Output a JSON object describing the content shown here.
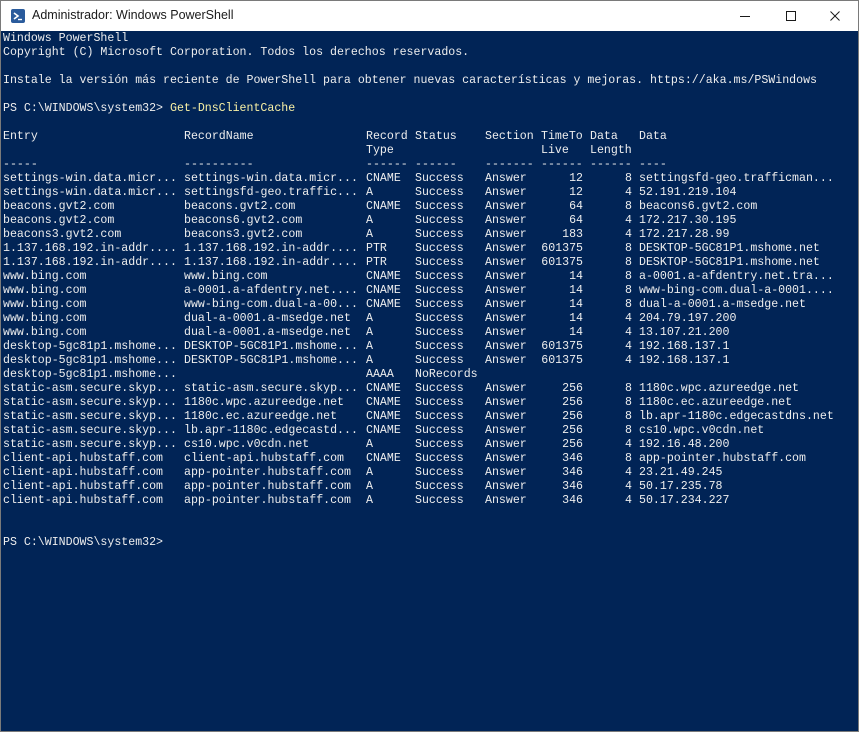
{
  "window": {
    "title": "Administrador: Windows PowerShell",
    "colors": {
      "background": "#012456",
      "text": "#eeeeee",
      "command": "#f9f1a5",
      "titlebar": "#ffffff"
    }
  },
  "console": {
    "banner": [
      "Windows PowerShell",
      "Copyright (C) Microsoft Corporation. Todos los derechos reservados.",
      "",
      "Instale la versión más reciente de PowerShell para obtener nuevas características y mejoras. https://aka.ms/PSWindows"
    ],
    "prompt": "PS C:\\WINDOWS\\system32> ",
    "command": "Get-DnsClientCache",
    "final_prompt": "PS C:\\WINDOWS\\system32>",
    "headers": {
      "entry": "Entry",
      "record_name": "RecordName",
      "record_type": [
        "Record",
        "Type"
      ],
      "status": "Status",
      "section": "Section",
      "ttl": [
        "TimeTo",
        "Live"
      ],
      "data_length": [
        "Data",
        "Length"
      ],
      "data": "Data"
    },
    "separators": {
      "entry": "-----",
      "record_name": "----------",
      "record_type": "------",
      "status": "------",
      "section": "-------",
      "ttl": "------",
      "data_length": "------",
      "data": "----"
    },
    "rows": [
      {
        "entry": "settings-win.data.micr...",
        "record_name": "settings-win.data.micr...",
        "type": "CNAME",
        "status": "Success",
        "section": "Answer",
        "ttl": "12",
        "length": "8",
        "data": "settingsfd-geo.trafficman..."
      },
      {
        "entry": "settings-win.data.micr...",
        "record_name": "settingsfd-geo.traffic...",
        "type": "A",
        "status": "Success",
        "section": "Answer",
        "ttl": "12",
        "length": "4",
        "data": "52.191.219.104"
      },
      {
        "entry": "beacons.gvt2.com",
        "record_name": "beacons.gvt2.com",
        "type": "CNAME",
        "status": "Success",
        "section": "Answer",
        "ttl": "64",
        "length": "8",
        "data": "beacons6.gvt2.com"
      },
      {
        "entry": "beacons.gvt2.com",
        "record_name": "beacons6.gvt2.com",
        "type": "A",
        "status": "Success",
        "section": "Answer",
        "ttl": "64",
        "length": "4",
        "data": "172.217.30.195"
      },
      {
        "entry": "beacons3.gvt2.com",
        "record_name": "beacons3.gvt2.com",
        "type": "A",
        "status": "Success",
        "section": "Answer",
        "ttl": "183",
        "length": "4",
        "data": "172.217.28.99"
      },
      {
        "entry": "1.137.168.192.in-addr....",
        "record_name": "1.137.168.192.in-addr....",
        "type": "PTR",
        "status": "Success",
        "section": "Answer",
        "ttl": "601375",
        "length": "8",
        "data": "DESKTOP-5GC81P1.mshome.net"
      },
      {
        "entry": "1.137.168.192.in-addr....",
        "record_name": "1.137.168.192.in-addr....",
        "type": "PTR",
        "status": "Success",
        "section": "Answer",
        "ttl": "601375",
        "length": "8",
        "data": "DESKTOP-5GC81P1.mshome.net"
      },
      {
        "entry": "www.bing.com",
        "record_name": "www.bing.com",
        "type": "CNAME",
        "status": "Success",
        "section": "Answer",
        "ttl": "14",
        "length": "8",
        "data": "a-0001.a-afdentry.net.tra..."
      },
      {
        "entry": "www.bing.com",
        "record_name": "a-0001.a-afdentry.net....",
        "type": "CNAME",
        "status": "Success",
        "section": "Answer",
        "ttl": "14",
        "length": "8",
        "data": "www-bing-com.dual-a-0001...."
      },
      {
        "entry": "www.bing.com",
        "record_name": "www-bing-com.dual-a-00...",
        "type": "CNAME",
        "status": "Success",
        "section": "Answer",
        "ttl": "14",
        "length": "8",
        "data": "dual-a-0001.a-msedge.net"
      },
      {
        "entry": "www.bing.com",
        "record_name": "dual-a-0001.a-msedge.net",
        "type": "A",
        "status": "Success",
        "section": "Answer",
        "ttl": "14",
        "length": "4",
        "data": "204.79.197.200"
      },
      {
        "entry": "www.bing.com",
        "record_name": "dual-a-0001.a-msedge.net",
        "type": "A",
        "status": "Success",
        "section": "Answer",
        "ttl": "14",
        "length": "4",
        "data": "13.107.21.200"
      },
      {
        "entry": "desktop-5gc81p1.mshome...",
        "record_name": "DESKTOP-5GC81P1.mshome...",
        "type": "A",
        "status": "Success",
        "section": "Answer",
        "ttl": "601375",
        "length": "4",
        "data": "192.168.137.1"
      },
      {
        "entry": "desktop-5gc81p1.mshome...",
        "record_name": "DESKTOP-5GC81P1.mshome...",
        "type": "A",
        "status": "Success",
        "section": "Answer",
        "ttl": "601375",
        "length": "4",
        "data": "192.168.137.1"
      },
      {
        "entry": "desktop-5gc81p1.mshome...",
        "record_name": "",
        "type": "AAAA",
        "status": "NoRecords",
        "section": "",
        "ttl": "",
        "length": "",
        "data": ""
      },
      {
        "entry": "static-asm.secure.skyp...",
        "record_name": "static-asm.secure.skyp...",
        "type": "CNAME",
        "status": "Success",
        "section": "Answer",
        "ttl": "256",
        "length": "8",
        "data": "1180c.wpc.azureedge.net"
      },
      {
        "entry": "static-asm.secure.skyp...",
        "record_name": "1180c.wpc.azureedge.net",
        "type": "CNAME",
        "status": "Success",
        "section": "Answer",
        "ttl": "256",
        "length": "8",
        "data": "1180c.ec.azureedge.net"
      },
      {
        "entry": "static-asm.secure.skyp...",
        "record_name": "1180c.ec.azureedge.net",
        "type": "CNAME",
        "status": "Success",
        "section": "Answer",
        "ttl": "256",
        "length": "8",
        "data": "lb.apr-1180c.edgecastdns.net"
      },
      {
        "entry": "static-asm.secure.skyp...",
        "record_name": "lb.apr-1180c.edgecastd...",
        "type": "CNAME",
        "status": "Success",
        "section": "Answer",
        "ttl": "256",
        "length": "8",
        "data": "cs10.wpc.v0cdn.net"
      },
      {
        "entry": "static-asm.secure.skyp...",
        "record_name": "cs10.wpc.v0cdn.net",
        "type": "A",
        "status": "Success",
        "section": "Answer",
        "ttl": "256",
        "length": "4",
        "data": "192.16.48.200"
      },
      {
        "entry": "client-api.hubstaff.com",
        "record_name": "client-api.hubstaff.com",
        "type": "CNAME",
        "status": "Success",
        "section": "Answer",
        "ttl": "346",
        "length": "8",
        "data": "app-pointer.hubstaff.com"
      },
      {
        "entry": "client-api.hubstaff.com",
        "record_name": "app-pointer.hubstaff.com",
        "type": "A",
        "status": "Success",
        "section": "Answer",
        "ttl": "346",
        "length": "4",
        "data": "23.21.49.245"
      },
      {
        "entry": "client-api.hubstaff.com",
        "record_name": "app-pointer.hubstaff.com",
        "type": "A",
        "status": "Success",
        "section": "Answer",
        "ttl": "346",
        "length": "4",
        "data": "50.17.235.78"
      },
      {
        "entry": "client-api.hubstaff.com",
        "record_name": "app-pointer.hubstaff.com",
        "type": "A",
        "status": "Success",
        "section": "Answer",
        "ttl": "346",
        "length": "4",
        "data": "50.17.234.227"
      }
    ]
  }
}
